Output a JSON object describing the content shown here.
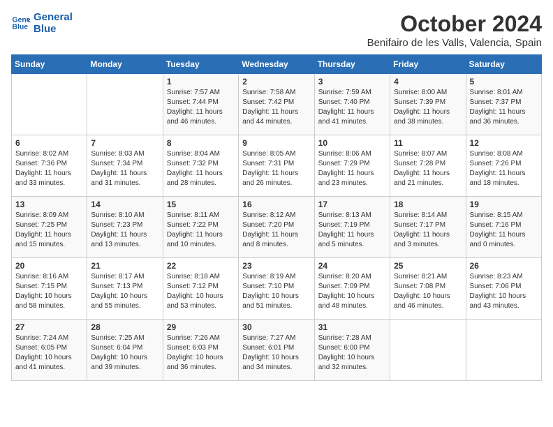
{
  "logo": {
    "line1": "General",
    "line2": "Blue"
  },
  "title": "October 2024",
  "location": "Benifairo de les Valls, Valencia, Spain",
  "weekdays": [
    "Sunday",
    "Monday",
    "Tuesday",
    "Wednesday",
    "Thursday",
    "Friday",
    "Saturday"
  ],
  "weeks": [
    [
      {
        "day": "",
        "info": ""
      },
      {
        "day": "",
        "info": ""
      },
      {
        "day": "1",
        "info": "Sunrise: 7:57 AM\nSunset: 7:44 PM\nDaylight: 11 hours and 46 minutes."
      },
      {
        "day": "2",
        "info": "Sunrise: 7:58 AM\nSunset: 7:42 PM\nDaylight: 11 hours and 44 minutes."
      },
      {
        "day": "3",
        "info": "Sunrise: 7:59 AM\nSunset: 7:40 PM\nDaylight: 11 hours and 41 minutes."
      },
      {
        "day": "4",
        "info": "Sunrise: 8:00 AM\nSunset: 7:39 PM\nDaylight: 11 hours and 38 minutes."
      },
      {
        "day": "5",
        "info": "Sunrise: 8:01 AM\nSunset: 7:37 PM\nDaylight: 11 hours and 36 minutes."
      }
    ],
    [
      {
        "day": "6",
        "info": "Sunrise: 8:02 AM\nSunset: 7:36 PM\nDaylight: 11 hours and 33 minutes."
      },
      {
        "day": "7",
        "info": "Sunrise: 8:03 AM\nSunset: 7:34 PM\nDaylight: 11 hours and 31 minutes."
      },
      {
        "day": "8",
        "info": "Sunrise: 8:04 AM\nSunset: 7:32 PM\nDaylight: 11 hours and 28 minutes."
      },
      {
        "day": "9",
        "info": "Sunrise: 8:05 AM\nSunset: 7:31 PM\nDaylight: 11 hours and 26 minutes."
      },
      {
        "day": "10",
        "info": "Sunrise: 8:06 AM\nSunset: 7:29 PM\nDaylight: 11 hours and 23 minutes."
      },
      {
        "day": "11",
        "info": "Sunrise: 8:07 AM\nSunset: 7:28 PM\nDaylight: 11 hours and 21 minutes."
      },
      {
        "day": "12",
        "info": "Sunrise: 8:08 AM\nSunset: 7:26 PM\nDaylight: 11 hours and 18 minutes."
      }
    ],
    [
      {
        "day": "13",
        "info": "Sunrise: 8:09 AM\nSunset: 7:25 PM\nDaylight: 11 hours and 15 minutes."
      },
      {
        "day": "14",
        "info": "Sunrise: 8:10 AM\nSunset: 7:23 PM\nDaylight: 11 hours and 13 minutes."
      },
      {
        "day": "15",
        "info": "Sunrise: 8:11 AM\nSunset: 7:22 PM\nDaylight: 11 hours and 10 minutes."
      },
      {
        "day": "16",
        "info": "Sunrise: 8:12 AM\nSunset: 7:20 PM\nDaylight: 11 hours and 8 minutes."
      },
      {
        "day": "17",
        "info": "Sunrise: 8:13 AM\nSunset: 7:19 PM\nDaylight: 11 hours and 5 minutes."
      },
      {
        "day": "18",
        "info": "Sunrise: 8:14 AM\nSunset: 7:17 PM\nDaylight: 11 hours and 3 minutes."
      },
      {
        "day": "19",
        "info": "Sunrise: 8:15 AM\nSunset: 7:16 PM\nDaylight: 11 hours and 0 minutes."
      }
    ],
    [
      {
        "day": "20",
        "info": "Sunrise: 8:16 AM\nSunset: 7:15 PM\nDaylight: 10 hours and 58 minutes."
      },
      {
        "day": "21",
        "info": "Sunrise: 8:17 AM\nSunset: 7:13 PM\nDaylight: 10 hours and 55 minutes."
      },
      {
        "day": "22",
        "info": "Sunrise: 8:18 AM\nSunset: 7:12 PM\nDaylight: 10 hours and 53 minutes."
      },
      {
        "day": "23",
        "info": "Sunrise: 8:19 AM\nSunset: 7:10 PM\nDaylight: 10 hours and 51 minutes."
      },
      {
        "day": "24",
        "info": "Sunrise: 8:20 AM\nSunset: 7:09 PM\nDaylight: 10 hours and 48 minutes."
      },
      {
        "day": "25",
        "info": "Sunrise: 8:21 AM\nSunset: 7:08 PM\nDaylight: 10 hours and 46 minutes."
      },
      {
        "day": "26",
        "info": "Sunrise: 8:23 AM\nSunset: 7:06 PM\nDaylight: 10 hours and 43 minutes."
      }
    ],
    [
      {
        "day": "27",
        "info": "Sunrise: 7:24 AM\nSunset: 6:05 PM\nDaylight: 10 hours and 41 minutes."
      },
      {
        "day": "28",
        "info": "Sunrise: 7:25 AM\nSunset: 6:04 PM\nDaylight: 10 hours and 39 minutes."
      },
      {
        "day": "29",
        "info": "Sunrise: 7:26 AM\nSunset: 6:03 PM\nDaylight: 10 hours and 36 minutes."
      },
      {
        "day": "30",
        "info": "Sunrise: 7:27 AM\nSunset: 6:01 PM\nDaylight: 10 hours and 34 minutes."
      },
      {
        "day": "31",
        "info": "Sunrise: 7:28 AM\nSunset: 6:00 PM\nDaylight: 10 hours and 32 minutes."
      },
      {
        "day": "",
        "info": ""
      },
      {
        "day": "",
        "info": ""
      }
    ]
  ]
}
